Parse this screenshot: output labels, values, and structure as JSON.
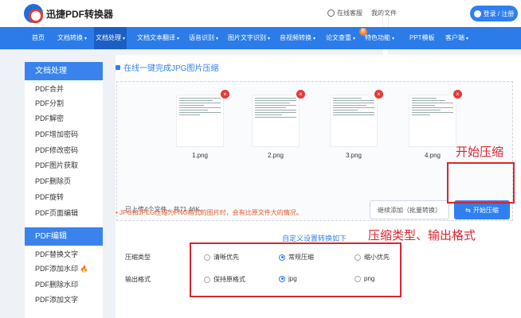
{
  "header": {
    "brand": "迅捷PDF转换器",
    "service": "在线客服",
    "my_files": "我的文件",
    "login": "登录 / 注册"
  },
  "nav": {
    "items": [
      {
        "label": "首页",
        "has_caret": false
      },
      {
        "label": "文档转换",
        "has_caret": true
      },
      {
        "label": "文档处理",
        "has_caret": true,
        "active": true
      },
      {
        "label": "文档文本翻译",
        "has_caret": true
      },
      {
        "label": "语音识别",
        "has_caret": true
      },
      {
        "label": "图片文字识别",
        "has_caret": true
      },
      {
        "label": "音视频转换",
        "has_caret": true
      },
      {
        "label": "论文查重",
        "has_caret": true,
        "badge": "新"
      },
      {
        "label": "特色功能",
        "has_caret": true
      },
      {
        "label": "PPT模板",
        "has_caret": false
      },
      {
        "label": "客户端",
        "has_caret": true
      }
    ]
  },
  "sidebar": {
    "group1_title": "文档处理",
    "group1_items": [
      "PDF合并",
      "PDF分割",
      "PDF解密",
      "PDF增加密码",
      "PDF修改密码",
      "PDF图片获取",
      "PDF删除页",
      "PDF旋转",
      "PDF页面编辑"
    ],
    "group2_title": "PDF编辑",
    "group2_items": [
      "PDF替换文字",
      "PDF添加水印",
      "PDF删除水印",
      "PDF添加文字"
    ]
  },
  "main": {
    "title": "在线一键完成JPG图片压缩",
    "files": [
      "1.png",
      "2.png",
      "3.png",
      "4.png"
    ],
    "upload_status": "已上传4个文件，共71.46K。",
    "continue_button": "继续添加（批量转换）",
    "compress_button": "开始压缩",
    "note": "• JPG和JPEG压缩为PNG格式的图片时，会有比原文件大的情况。",
    "custom_link": "自定义设置转换如下",
    "compress_type": {
      "label": "压缩类型",
      "options": [
        "清晰优先",
        "常规压缩",
        "缩小优先"
      ],
      "selected": "常规压缩"
    },
    "output_format": {
      "label": "输出格式",
      "options": [
        "保持原格式",
        "jpg",
        "png"
      ],
      "selected": "jpg"
    }
  },
  "annotations": {
    "start": "开始压缩",
    "type_format": "压缩类型、输出格式"
  },
  "colors": {
    "primary": "#2f7ff0",
    "nav_bg": "#2b7ce9",
    "annotation_red": "#d8262f"
  }
}
